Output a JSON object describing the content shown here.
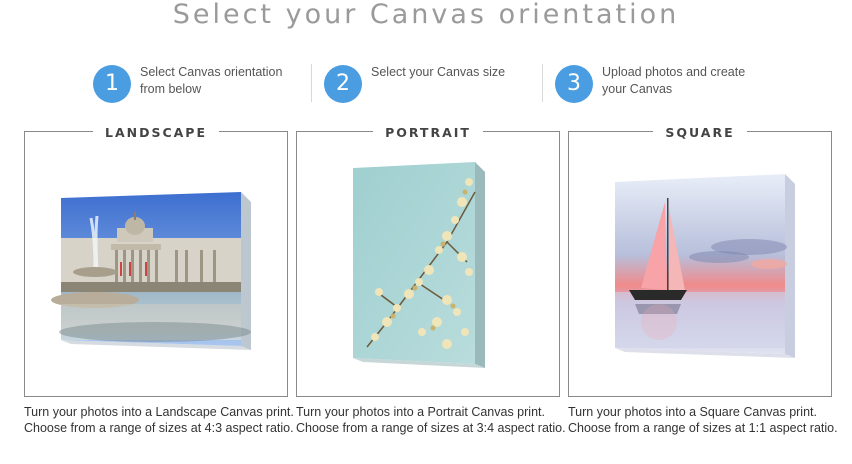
{
  "page": {
    "title": "Select your Canvas orientation"
  },
  "steps": [
    {
      "number": "1",
      "text": "Select Canvas orientation from below"
    },
    {
      "number": "2",
      "text": "Select your Canvas size"
    },
    {
      "number": "3",
      "text": "Upload photos and create your Canvas"
    }
  ],
  "options": [
    {
      "label": "LANDSCAPE",
      "description": "Turn your photos into a Landscape Canvas print. Choose from a range of sizes at 4:3 aspect ratio."
    },
    {
      "label": "PORTRAIT",
      "description": "Turn your photos into a Portrait Canvas print. Choose from a range of sizes at 3:4 aspect ratio."
    },
    {
      "label": "SQUARE",
      "description": "Turn your photos into a Square Canvas print. Choose from a range of sizes at 1:1 aspect ratio."
    }
  ],
  "colors": {
    "accent": "#4a9de0",
    "title": "#9a9a9a",
    "border": "#8a8a8a"
  }
}
